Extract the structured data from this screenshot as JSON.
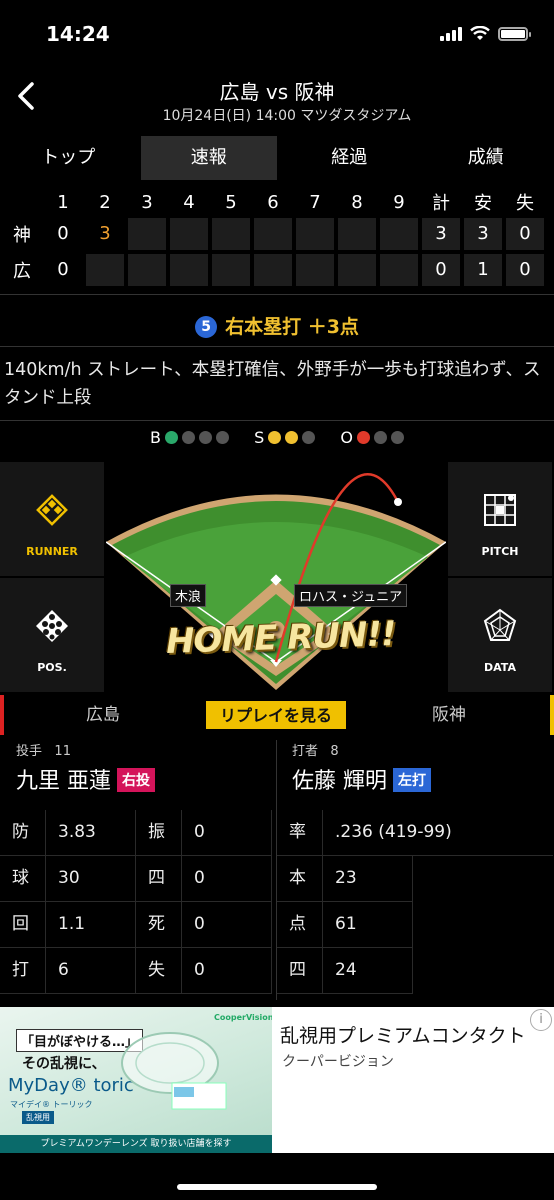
{
  "status": {
    "time": "14:24"
  },
  "header": {
    "title": "広島 vs 阪神",
    "subtitle": "10月24日(日) 14:00 マツダスタジアム"
  },
  "tabs": [
    {
      "label": "トップ",
      "active": false
    },
    {
      "label": "速報",
      "active": true
    },
    {
      "label": "経過",
      "active": false
    },
    {
      "label": "成績",
      "active": false
    }
  ],
  "scoreboard": {
    "headers": [
      "1",
      "2",
      "3",
      "4",
      "5",
      "6",
      "7",
      "8",
      "9",
      "計",
      "安",
      "失"
    ],
    "rows": [
      {
        "team": "神",
        "innings": [
          "0",
          "3",
          "",
          "",
          "",
          "",
          "",
          "",
          ""
        ],
        "totals": [
          "3",
          "3",
          "0"
        ]
      },
      {
        "team": "広",
        "innings": [
          "0",
          "",
          "",
          "",
          "",
          "",
          "",
          "",
          ""
        ],
        "totals": [
          "0",
          "1",
          "0"
        ]
      }
    ]
  },
  "play": {
    "batter_num": "5",
    "title": "右本塁打 ＋3点",
    "description": "140km/h ストレート、本塁打確信、外野手が一歩も打球追わず、スタンド上段"
  },
  "count": {
    "b_label": "B",
    "s_label": "S",
    "o_label": "O",
    "balls": 1,
    "strikes": 2,
    "outs": 1,
    "colors": {
      "ball": "#2aa86a",
      "strike": "#f0c030",
      "out": "#e03a2a"
    }
  },
  "field": {
    "runner_label": "RUNNER",
    "pitch_label": "PITCH",
    "pos_label": "POS.",
    "data_label": "DATA",
    "pitcher_tag": "木浪",
    "batter_tag": "ロハス・ジュニア",
    "banner": "HOME RUN!!"
  },
  "teambar": {
    "home": "広島",
    "replay": "リプレイを見る",
    "away": "阪神"
  },
  "pitcher": {
    "role": "投手",
    "number": "11",
    "name": "九里 亜蓮",
    "hand": "右投"
  },
  "batter": {
    "role": "打者",
    "number": "8",
    "name": "佐藤 輝明",
    "hand": "左打"
  },
  "pitcher_stats": [
    [
      "防",
      "3.83",
      "振",
      "0"
    ],
    [
      "球",
      "30",
      "四",
      "0"
    ],
    [
      "回",
      "1.1",
      "死",
      "0"
    ],
    [
      "打",
      "6",
      "失",
      "0"
    ]
  ],
  "batter_stats": [
    [
      "率",
      ".236 (419-99)"
    ],
    [
      "本",
      "23"
    ],
    [
      "点",
      "61"
    ],
    [
      "四",
      "24"
    ]
  ],
  "ad": {
    "headline": "乱視用プレミアムコンタクト",
    "brand": "クーパービジョン",
    "img_q": "「目がぼやける…」",
    "img_q2": "その乱視に、",
    "product": "MyDay® toric",
    "product_kana": "マイデイ® トーリック",
    "tag": "乱視用",
    "bottom": "プレミアムワンデーレンズ 取り扱い店舗を探す",
    "logo": "CooperVision"
  }
}
